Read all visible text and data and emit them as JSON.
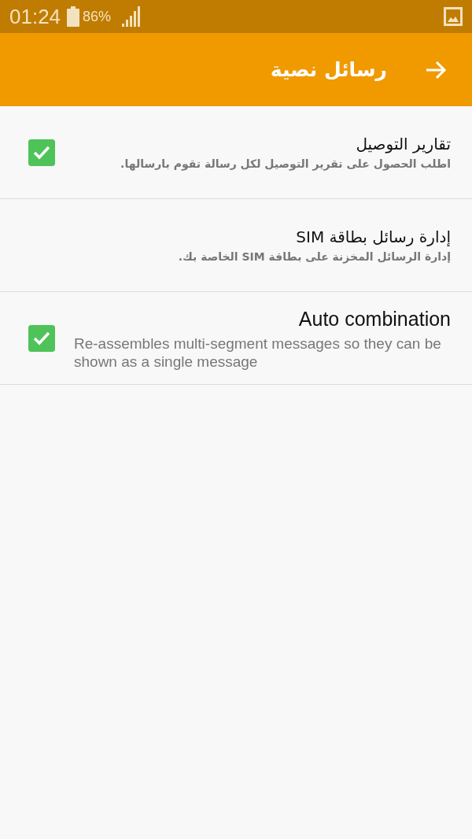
{
  "status_bar": {
    "time": "01:24",
    "battery": "86%"
  },
  "app_bar": {
    "title": "رسائل نصية"
  },
  "settings": [
    {
      "kind": "checkbox",
      "title": "تقارير التوصيل",
      "description": "اطلب الحصول على تقرير التوصيل لكل رسالة تقوم بارسالها.",
      "checked": true
    },
    {
      "kind": "link",
      "title": "إدارة رسائل بطاقة SIM",
      "description": "إدارة الرسائل المخزنة على بطاقة SIM الخاصة بك."
    },
    {
      "kind": "checkbox",
      "title": "Auto combination",
      "description": "Re-assembles multi-segment messages so they can be shown as a single message",
      "checked": true
    }
  ]
}
